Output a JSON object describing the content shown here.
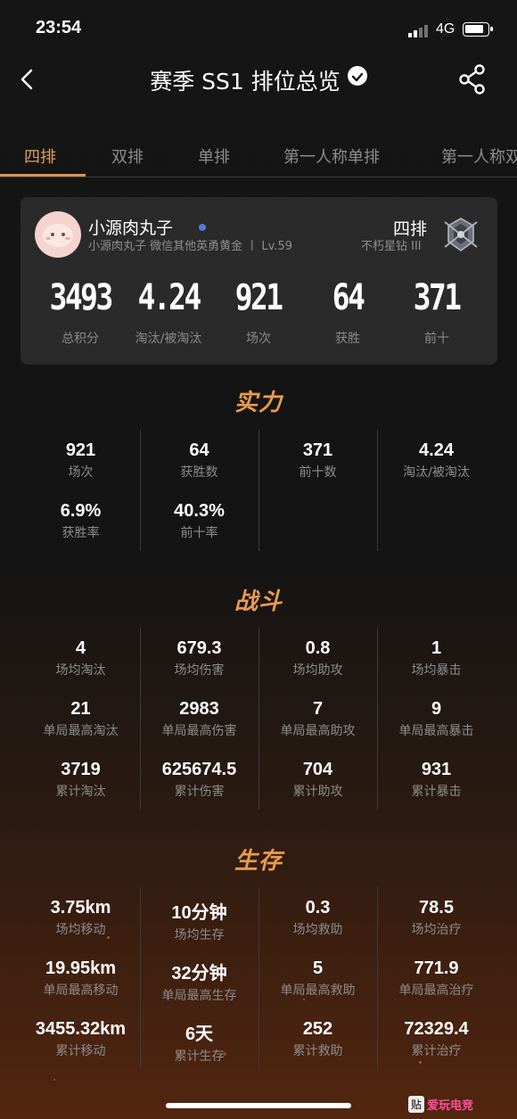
{
  "status_bar": {
    "time": "23:54",
    "network": "4G"
  },
  "nav": {
    "title": "赛季 SS1 排位总览"
  },
  "tabs": [
    "四排",
    "双排",
    "单排",
    "第一人称单排",
    "第一人称双"
  ],
  "profile": {
    "name": "小源肉丸子",
    "subtitle": "小源肉丸子   微信其他英勇黄金 丨 Lv.59",
    "mode": "四排",
    "tier": "不朽星钻 III",
    "stats": [
      {
        "value": "3493",
        "label": "总积分"
      },
      {
        "value": "4.24",
        "label": "淘汰/被淘汰"
      },
      {
        "value": "921",
        "label": "场次"
      },
      {
        "value": "64",
        "label": "获胜"
      },
      {
        "value": "371",
        "label": "前十"
      }
    ]
  },
  "sections": {
    "strength": {
      "title": "实力",
      "items": [
        {
          "value": "921",
          "label": "场次"
        },
        {
          "value": "64",
          "label": "获胜数"
        },
        {
          "value": "371",
          "label": "前十数"
        },
        {
          "value": "4.24",
          "label": "淘汰/被淘汰"
        },
        {
          "value": "6.9%",
          "label": "获胜率"
        },
        {
          "value": "40.3%",
          "label": "前十率"
        }
      ]
    },
    "combat": {
      "title": "战斗",
      "items": [
        {
          "value": "4",
          "label": "场均淘汰"
        },
        {
          "value": "679.3",
          "label": "场均伤害"
        },
        {
          "value": "0.8",
          "label": "场均助攻"
        },
        {
          "value": "1",
          "label": "场均暴击"
        },
        {
          "value": "21",
          "label": "单局最高淘汰"
        },
        {
          "value": "2983",
          "label": "单局最高伤害"
        },
        {
          "value": "7",
          "label": "单局最高助攻"
        },
        {
          "value": "9",
          "label": "单局最高暴击"
        },
        {
          "value": "3719",
          "label": "累计淘汰"
        },
        {
          "value": "625674.5",
          "label": "累计伤害"
        },
        {
          "value": "704",
          "label": "累计助攻"
        },
        {
          "value": "931",
          "label": "累计暴击"
        }
      ]
    },
    "survival": {
      "title": "生存",
      "items": [
        {
          "value": "3.75km",
          "label": "场均移动"
        },
        {
          "value": "10分钟",
          "label": "场均生存"
        },
        {
          "value": "0.3",
          "label": "场均救助"
        },
        {
          "value": "78.5",
          "label": "场均治疗"
        },
        {
          "value": "19.95km",
          "label": "单局最高移动"
        },
        {
          "value": "32分钟",
          "label": "单局最高生存"
        },
        {
          "value": "5",
          "label": "单局最高救助"
        },
        {
          "value": "771.9",
          "label": "单局最高治疗"
        },
        {
          "value": "3455.32km",
          "label": "累计移动"
        },
        {
          "value": "6天",
          "label": "累计生存"
        },
        {
          "value": "252",
          "label": "累计救助"
        },
        {
          "value": "72329.4",
          "label": "累计治疗"
        }
      ]
    }
  },
  "watermark": {
    "paste": "贴",
    "brand": "爱玩电竞"
  }
}
